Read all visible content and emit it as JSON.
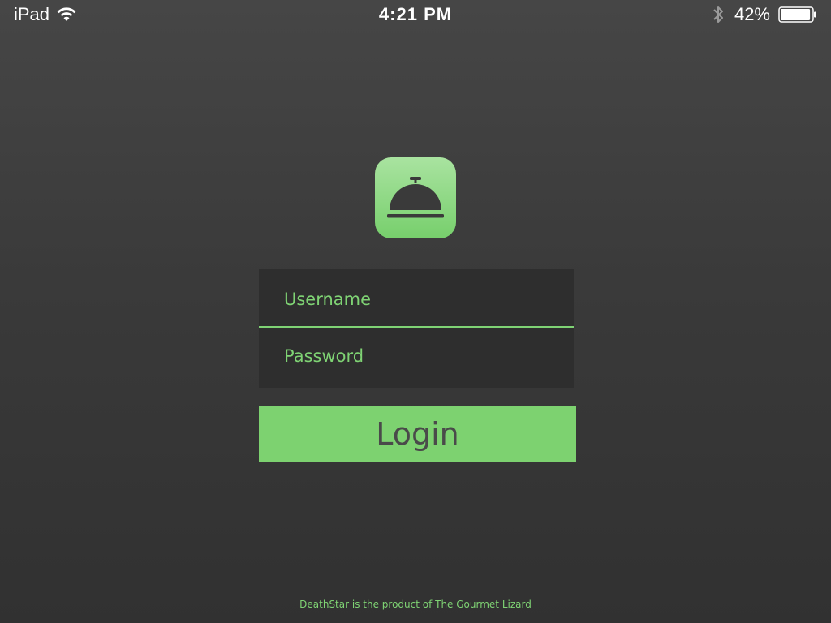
{
  "status_bar": {
    "carrier": "iPad",
    "time": "4:21 PM",
    "battery_percent": "42%",
    "battery_level": 0.95,
    "icons": [
      "wifi-icon",
      "bluetooth-icon",
      "battery-icon"
    ]
  },
  "logo": {
    "icon": "service-bell-icon",
    "colors": {
      "top": "#a9e3a0",
      "bottom": "#77cf6c",
      "glyph": "#3a3a3a"
    }
  },
  "form": {
    "username_placeholder": "Username",
    "username_value": "",
    "password_placeholder": "Password",
    "password_value": ""
  },
  "login_button": {
    "label": "Login"
  },
  "footer": {
    "text": "DeathStar is the product of The Gourmet Lizard"
  },
  "colors": {
    "accent": "#7dd270",
    "background": "#3a3a3a",
    "field_background": "#2e2e2e",
    "button_text": "#4a4a4a"
  }
}
